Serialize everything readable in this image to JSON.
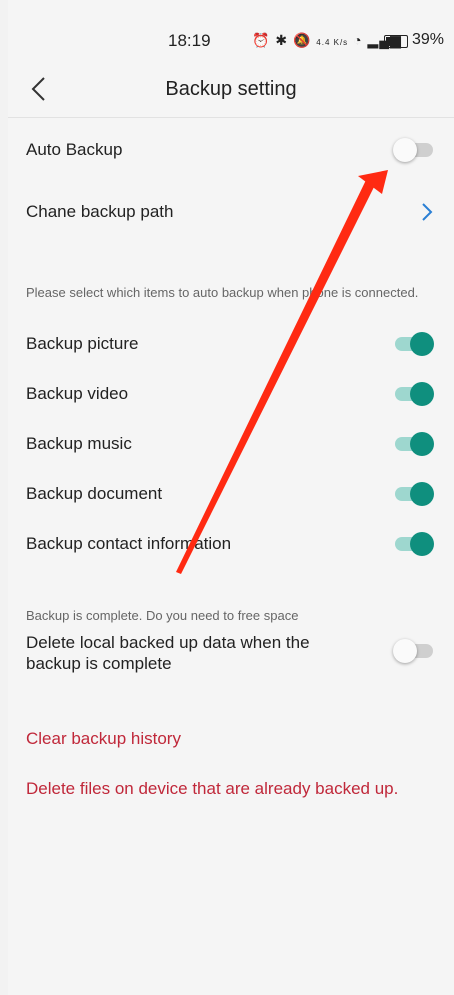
{
  "status_bar": {
    "time": "18:19",
    "net_speed": "4.4 K/s",
    "battery": "39%",
    "battery_fraction": 0.39
  },
  "header": {
    "title": "Backup setting"
  },
  "auto_backup": {
    "label": "Auto Backup",
    "enabled": false
  },
  "backup_path": {
    "label": "Chane backup path"
  },
  "items_hint": "Please select which items to auto backup when phone is connected.",
  "items": [
    {
      "label": "Backup picture",
      "enabled": true
    },
    {
      "label": "Backup video",
      "enabled": true
    },
    {
      "label": "Backup music",
      "enabled": true
    },
    {
      "label": "Backup document",
      "enabled": true
    },
    {
      "label": "Backup contact information",
      "enabled": true
    }
  ],
  "free_space": {
    "hint": "Backup is complete. Do you need to free space",
    "label": "Delete local backed up data when the backup is complete",
    "enabled": false
  },
  "actions": {
    "clear_history": "Clear backup history",
    "delete_files": "Delete files on device that are already backed up."
  },
  "colors": {
    "accent": "#0f8f7e",
    "accent_track": "#9ed7cf",
    "danger": "#c0283a",
    "link": "#2a7fd4",
    "annotation_arrow": "#ff2a12"
  }
}
